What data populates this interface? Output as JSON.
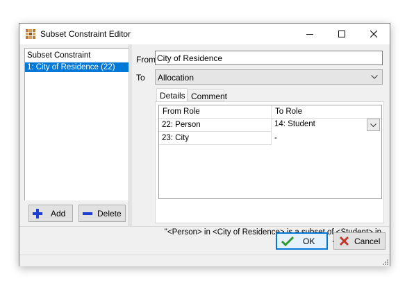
{
  "window": {
    "title": "Subset Constraint Editor"
  },
  "left": {
    "header": "Subset Constraint",
    "items": [
      "1: City of Residence (22)"
    ],
    "add_label": "Add",
    "delete_label": "Delete"
  },
  "form": {
    "from_label": "From",
    "from_value": "City of Residence",
    "to_label": "To",
    "to_value": "Allocation"
  },
  "tabs": [
    "Details",
    "Comment"
  ],
  "grid": {
    "columns": [
      "From Role",
      "To Role"
    ],
    "rows": [
      [
        "22: Person",
        "14: Student"
      ],
      [
        "23: City",
        "-"
      ]
    ]
  },
  "summary": "\"<Person> in <City of Residence> is a subset of <Student> in <Allocation>.\"",
  "footer": {
    "ok_label": "OK",
    "cancel_label": "Cancel"
  },
  "colors": {
    "selection": "#0078d7",
    "ok_check": "#2e9a2e",
    "cancel_x": "#c0392b",
    "add_icon": "#1f3fd1"
  }
}
